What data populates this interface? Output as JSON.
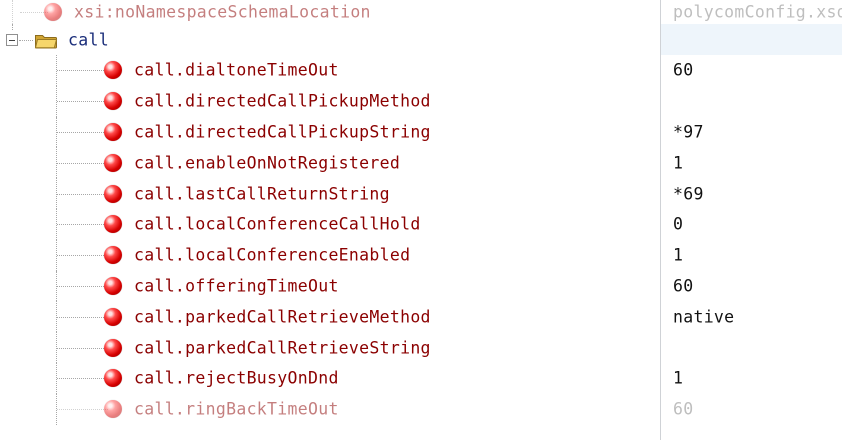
{
  "tree": {
    "namespace_row": {
      "name": "xsi:noNamespaceSchemaLocation",
      "value": "polycomConfig.xsd"
    },
    "call_node": {
      "name": "call"
    },
    "items": [
      {
        "name": "call.dialtoneTimeOut",
        "value": "60"
      },
      {
        "name": "call.directedCallPickupMethod",
        "value": ""
      },
      {
        "name": "call.directedCallPickupString",
        "value": "*97"
      },
      {
        "name": "call.enableOnNotRegistered",
        "value": "1"
      },
      {
        "name": "call.lastCallReturnString",
        "value": "*69"
      },
      {
        "name": "call.localConferenceCallHold",
        "value": "0"
      },
      {
        "name": "call.localConferenceEnabled",
        "value": "1"
      },
      {
        "name": "call.offeringTimeOut",
        "value": "60"
      },
      {
        "name": "call.parkedCallRetrieveMethod",
        "value": "native"
      },
      {
        "name": "call.parkedCallRetrieveString",
        "value": ""
      },
      {
        "name": "call.rejectBusyOnDnd",
        "value": "1"
      },
      {
        "name": "call.ringBackTimeOut",
        "value": "60"
      }
    ]
  },
  "colors": {
    "attribute_text": "#8b0000",
    "node_text": "#1a2d7a",
    "value_text": "#111111",
    "attribute_icon": "#d60000",
    "folder_icon": "#e9c247",
    "selection_bg": "#eef5fb",
    "tree_lines": "#a7a7a7"
  },
  "icons": {
    "attribute": "red-ball-icon",
    "node": "folder-open-icon",
    "toggle": "collapse-minus-icon"
  }
}
